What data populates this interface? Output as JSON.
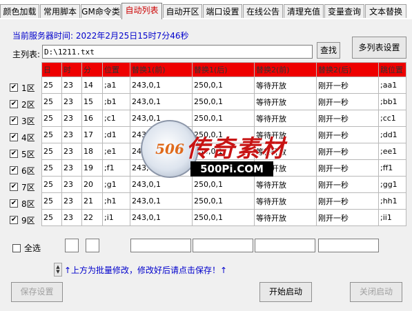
{
  "tabs": [
    {
      "label": "颜色加载",
      "active": false
    },
    {
      "label": "常用脚本",
      "active": false
    },
    {
      "label": "GM命令类",
      "active": false
    },
    {
      "label": "自动列表",
      "active": true
    },
    {
      "label": "自动开区",
      "active": false
    },
    {
      "label": "端口设置",
      "active": false
    },
    {
      "label": "在线公告",
      "active": false
    },
    {
      "label": "清理充值",
      "active": false
    },
    {
      "label": "变量查询",
      "active": false
    },
    {
      "label": "文本替换",
      "active": false
    }
  ],
  "server_time": "当前服务器时间: 2022年2月25日15时7分46秒",
  "main_list": {
    "label": "主列表:",
    "path": "D:\\1211.txt",
    "search_button": "查找"
  },
  "multi_list_button": "多列表设置",
  "table": {
    "headers": [
      "日",
      "时",
      "分",
      "位置",
      "替换1(前)",
      "替换1(后)",
      "替换2(前)",
      "替换2(后)",
      "跳位置"
    ],
    "rows": [
      {
        "zone": "1区",
        "checked": true,
        "cells": [
          "25",
          "23",
          "14",
          ";a1",
          "243,0,1",
          "250,0,1",
          "等待开放",
          "刚开一秒",
          ";aa1"
        ]
      },
      {
        "zone": "2区",
        "checked": true,
        "cells": [
          "25",
          "23",
          "15",
          ";b1",
          "243,0,1",
          "250,0,1",
          "等待开放",
          "刚开一秒",
          ";bb1"
        ]
      },
      {
        "zone": "3区",
        "checked": true,
        "cells": [
          "25",
          "23",
          "16",
          ";c1",
          "243,0,1",
          "250,0,1",
          "等待开放",
          "刚开一秒",
          ";cc1"
        ]
      },
      {
        "zone": "4区",
        "checked": true,
        "cells": [
          "25",
          "23",
          "17",
          ";d1",
          "243,0,1",
          "250,0,1",
          "等待开放",
          "刚开一秒",
          ";dd1"
        ]
      },
      {
        "zone": "5区",
        "checked": true,
        "cells": [
          "25",
          "23",
          "18",
          ";e1",
          "243,0,1",
          "250,0,1",
          "等待开放",
          "刚开一秒",
          ";ee1"
        ]
      },
      {
        "zone": "6区",
        "checked": true,
        "cells": [
          "25",
          "23",
          "19",
          ";f1",
          "243,0,1",
          "250,0,1",
          "等待开放",
          "刚开一秒",
          ";ff1"
        ]
      },
      {
        "zone": "7区",
        "checked": true,
        "cells": [
          "25",
          "23",
          "20",
          ";g1",
          "243,0,1",
          "250,0,1",
          "等待开放",
          "刚开一秒",
          ";gg1"
        ]
      },
      {
        "zone": "8区",
        "checked": true,
        "cells": [
          "25",
          "23",
          "21",
          ";h1",
          "243,0,1",
          "250,0,1",
          "等待开放",
          "刚开一秒",
          ";hh1"
        ]
      },
      {
        "zone": "9区",
        "checked": true,
        "cells": [
          "25",
          "23",
          "22",
          ";i1",
          "243,0,1",
          "250,0,1",
          "等待开放",
          "刚开一秒",
          ";ii1"
        ]
      }
    ]
  },
  "select_all": {
    "label": "全选",
    "checked": false
  },
  "batch_hint": "↑上方为批量修改，修改好后请点击保存！↑",
  "buttons": {
    "save": "保存设置",
    "start": "开始启动",
    "close": "关闭启动"
  },
  "watermark": {
    "circle_text": "506",
    "brand": "传奇素材",
    "url": "500Pi.COM"
  },
  "colors": {
    "header_red": "#ee0000",
    "active_tab_text": "#cc0000",
    "hint_blue": "#0000cc"
  }
}
